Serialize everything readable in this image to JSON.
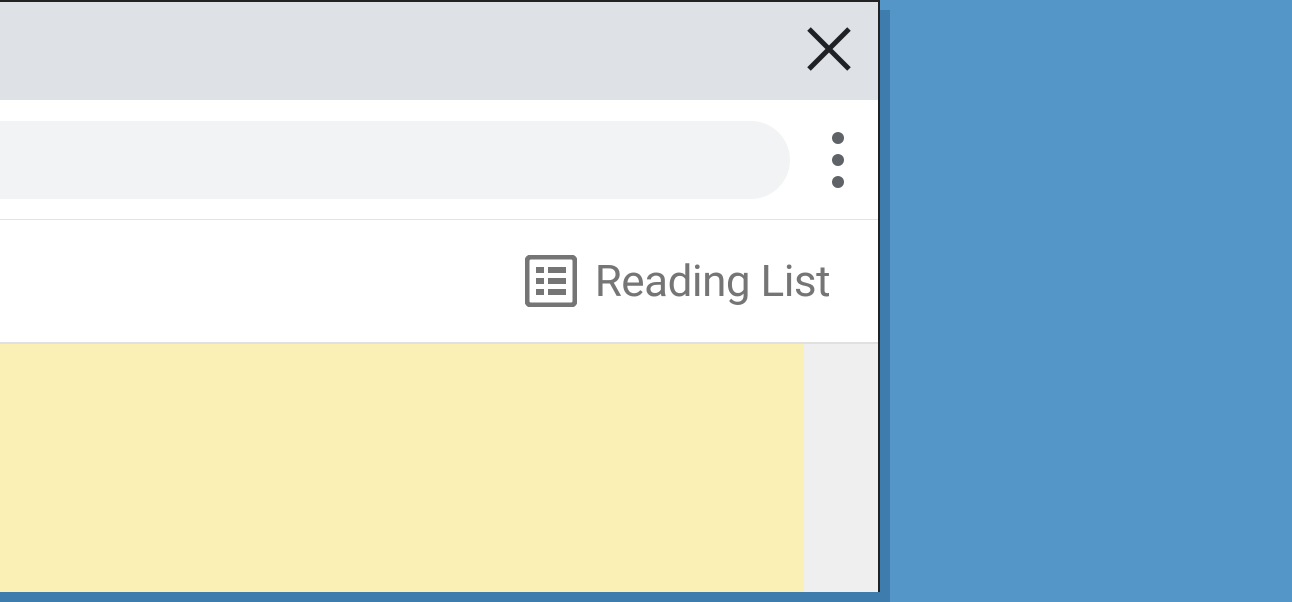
{
  "bookmarks": {
    "reading_list_label": "Reading List"
  },
  "icons": {
    "close": "close-icon",
    "kebab": "more-vert-icon",
    "reading_list": "reading-list-icon"
  },
  "colors": {
    "background": "#5596c9",
    "titlebar": "#dee1e6",
    "omnibox": "#f1f3f4",
    "content": "#faefb5",
    "icon_gray": "#5f6368",
    "text_gray": "#757575"
  }
}
